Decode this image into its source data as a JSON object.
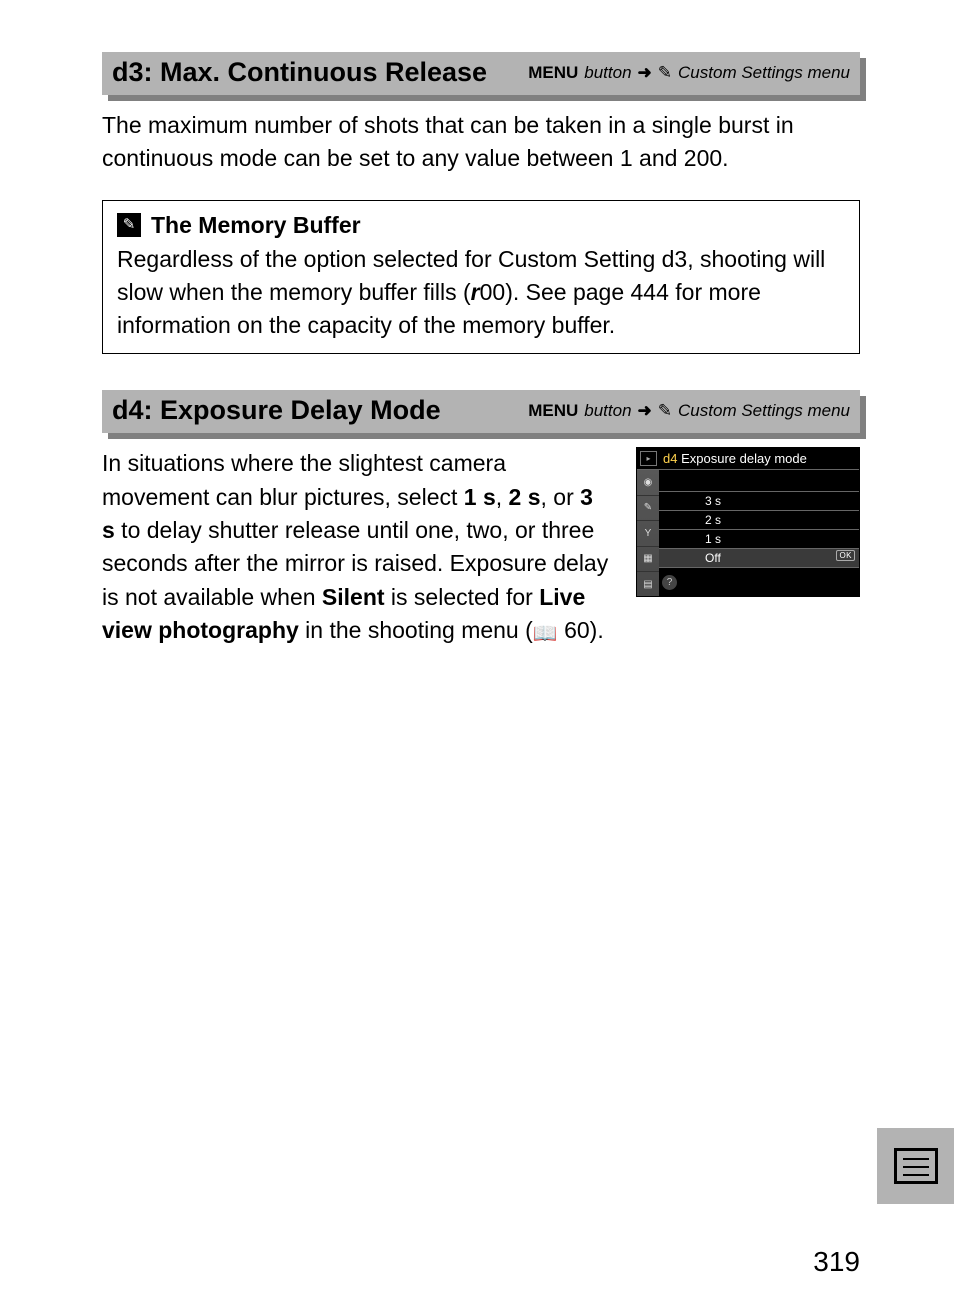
{
  "headings": {
    "d3": {
      "title": "d3: Max.  Continuous Release",
      "menu_label": "MENU",
      "menu_word": "button",
      "arrow": "➜",
      "pencil": "✎",
      "path_tail": "Custom Settings menu"
    },
    "d4": {
      "title": "d4: Exposure Delay Mode",
      "menu_label": "MENU",
      "menu_word": "button",
      "arrow": "➜",
      "pencil": "✎",
      "path_tail": "Custom Settings menu"
    }
  },
  "d3_body": "The maximum number of shots that can be taken in a single burst in continuous mode can be set to any value between 1 and 200.",
  "note": {
    "icon": "✎",
    "title": "The Memory Buffer",
    "body_pre": "Regardless of the option selected for Custom Setting d3, shooting will slow when the memory buffer fills (",
    "buffer_glyph": "r",
    "buffer_value": "00",
    "body_post": ").  See page 444 for more information on the capacity of the memory buffer."
  },
  "d4_body": {
    "p1a": "In situations where the slightest camera movement can blur pictures, select ",
    "b1": "1 s",
    "comma1": ", ",
    "b2": "2 s",
    "comma2": ", or ",
    "b3": "3 s",
    "p1b": " to delay shutter release until one, two, or three seconds after the mirror is raised. Exposure delay is not available when ",
    "b4": "Silent",
    "p1c": " is selected for ",
    "b5": "Live view photography",
    "p1d": " in the shooting menu (",
    "book": "📖",
    "page_ref": " 60)."
  },
  "lcd": {
    "title_prefix": "d4",
    "title_text": "Exposure delay mode",
    "options": [
      "3 s",
      "2 s",
      "1 s",
      "Off"
    ],
    "selected_index": 3,
    "ok": "OK",
    "side_icons": [
      "▸",
      "◉",
      "✎",
      "Y",
      "▦",
      "▤"
    ],
    "help": "?"
  },
  "page_number": "319"
}
